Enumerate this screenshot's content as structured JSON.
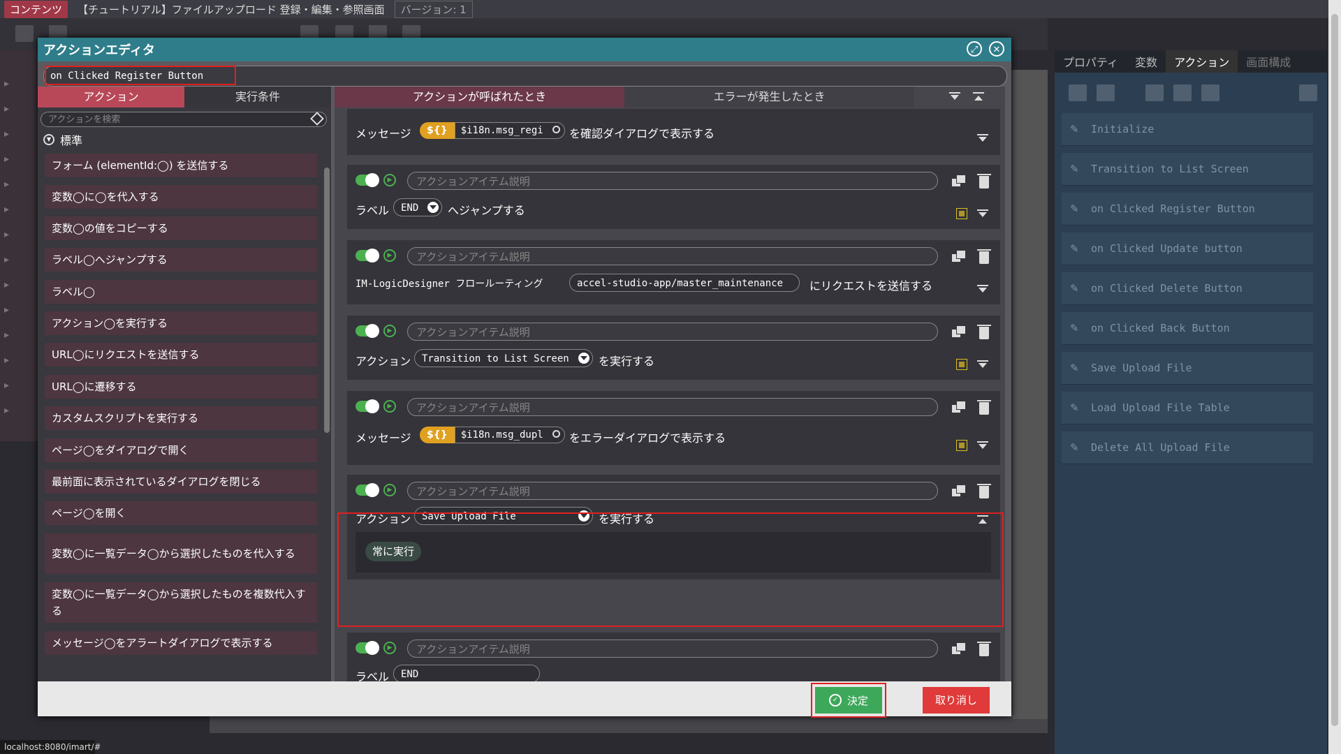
{
  "topbar": {
    "tag": "コンテンツ",
    "title": "【チュートリアル】ファイルアップロード 登録・編集・参照画面",
    "version": "バージョン: 1"
  },
  "dialog": {
    "title": "アクションエディタ",
    "action_name": "on Clicked Register Button",
    "left_tabs": [
      "アクション",
      "実行条件"
    ],
    "search_placeholder": "アクションを検索",
    "category": "標準",
    "palette_items": [
      "フォーム (elementId:◯) を送信する",
      "変数◯に◯を代入する",
      "変数◯の値をコピーする",
      "ラベル◯へジャンプする",
      "ラベル◯",
      "アクション◯を実行する",
      "URL◯にリクエストを送信する",
      "URL◯に遷移する",
      "カスタムスクリプトを実行する",
      "ページ◯をダイアログで開く",
      "最前面に表示されているダイアログを閉じる",
      "ページ◯を開く",
      "変数◯に一覧データ◯から選択したものを代入する",
      "変数◯に一覧データ◯から選択したものを複数代入する",
      "メッセージ◯をアラートダイアログで表示する"
    ],
    "right_tabs": [
      "アクションが呼ばれたとき",
      "エラーが発生したとき"
    ],
    "desc_placeholder": "アクションアイテム説明",
    "card0": {
      "label": "メッセージ",
      "var": "$i18n.msg_regi",
      "suffix": "を確認ダイアログで表示する"
    },
    "card1": {
      "label": "ラベル",
      "value": "END",
      "suffix": "へジャンプする"
    },
    "card2": {
      "label": "IM-LogicDesigner フロールーティング",
      "value": "accel-studio-app/master_maintenance",
      "suffix": "にリクエストを送信する"
    },
    "card3": {
      "label": "アクション",
      "value": "Transition to List Screen",
      "suffix": "を実行する"
    },
    "card4": {
      "label": "メッセージ",
      "var": "$i18n.msg_dupl",
      "suffix": "をエラーダイアログで表示する"
    },
    "card5": {
      "label": "アクション",
      "value": "Save Upload File",
      "suffix": "を実行する",
      "condition": "常に実行"
    },
    "card6": {
      "label": "ラベル",
      "value": "END"
    },
    "var_prefix": "${}",
    "ok": "決定",
    "cancel": "取り消し"
  },
  "right_panel": {
    "tabs": [
      "プロパティ",
      "変数",
      "アクション",
      "画面構成"
    ],
    "actions": [
      "Initialize",
      "Transition to List Screen",
      "on Clicked Register Button",
      "on Clicked Update button",
      "on Clicked Delete Button",
      "on Clicked Back Button",
      "Save Upload File",
      "Load Upload File Table",
      "Delete All Upload File"
    ]
  },
  "status_url": "localhost:8080/imart/#",
  "colors": {
    "accent": "#2f7d8a",
    "active_tab": "#b84858",
    "ok": "#3ea85a",
    "cancel": "#e03a3a",
    "highlight": "#e02020"
  }
}
